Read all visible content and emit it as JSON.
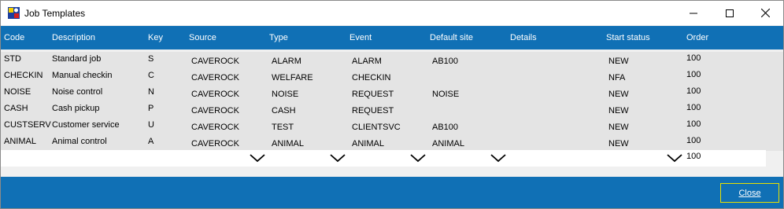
{
  "window": {
    "title": "Job Templates"
  },
  "columns": {
    "code": "Code",
    "description": "Description",
    "key": "Key",
    "source": "Source",
    "type": "Type",
    "event": "Event",
    "default_site": "Default site",
    "details": "Details",
    "start_status": "Start status",
    "order": "Order"
  },
  "rows": [
    {
      "code": "STD",
      "description": "Standard job",
      "key": "S",
      "source": "CAVEROCK",
      "type": "ALARM",
      "event": "ALARM",
      "default_site": "AB100",
      "details": "",
      "start_status": "NEW",
      "order": "100"
    },
    {
      "code": "CHECKIN",
      "description": "Manual checkin",
      "key": "C",
      "source": "CAVEROCK",
      "type": "WELFARE",
      "event": "CHECKIN",
      "default_site": "",
      "details": "",
      "start_status": "NFA",
      "order": "100"
    },
    {
      "code": "NOISE",
      "description": "Noise control",
      "key": "N",
      "source": "CAVEROCK",
      "type": "NOISE",
      "event": "REQUEST",
      "default_site": "NOISE",
      "details": "",
      "start_status": "NEW",
      "order": "100"
    },
    {
      "code": "CASH",
      "description": "Cash pickup",
      "key": "P",
      "source": "CAVEROCK",
      "type": "CASH",
      "event": "REQUEST",
      "default_site": "",
      "details": "",
      "start_status": "NEW",
      "order": "100"
    },
    {
      "code": "CUSTSERV",
      "description": "Customer service",
      "key": "U",
      "source": "CAVEROCK",
      "type": "TEST",
      "event": "CLIENTSVC",
      "default_site": "AB100",
      "details": "",
      "start_status": "NEW",
      "order": "100"
    },
    {
      "code": "ANIMAL",
      "description": "Animal control",
      "key": "A",
      "source": "CAVEROCK",
      "type": "ANIMAL",
      "event": "ANIMAL",
      "default_site": "ANIMAL",
      "details": "",
      "start_status": "NEW",
      "order": "100"
    }
  ],
  "new_row": {
    "order": "100"
  },
  "footer": {
    "close_label": "Close"
  },
  "colors": {
    "header_bg": "#1070b5",
    "row_bg": "#e4e4e4",
    "close_border": "#e8e000"
  },
  "icons": {
    "app": "app-icon",
    "minimize": "minimize-icon",
    "maximize": "maximize-icon",
    "close": "close-icon",
    "dropdown": "chevron-down-icon"
  }
}
